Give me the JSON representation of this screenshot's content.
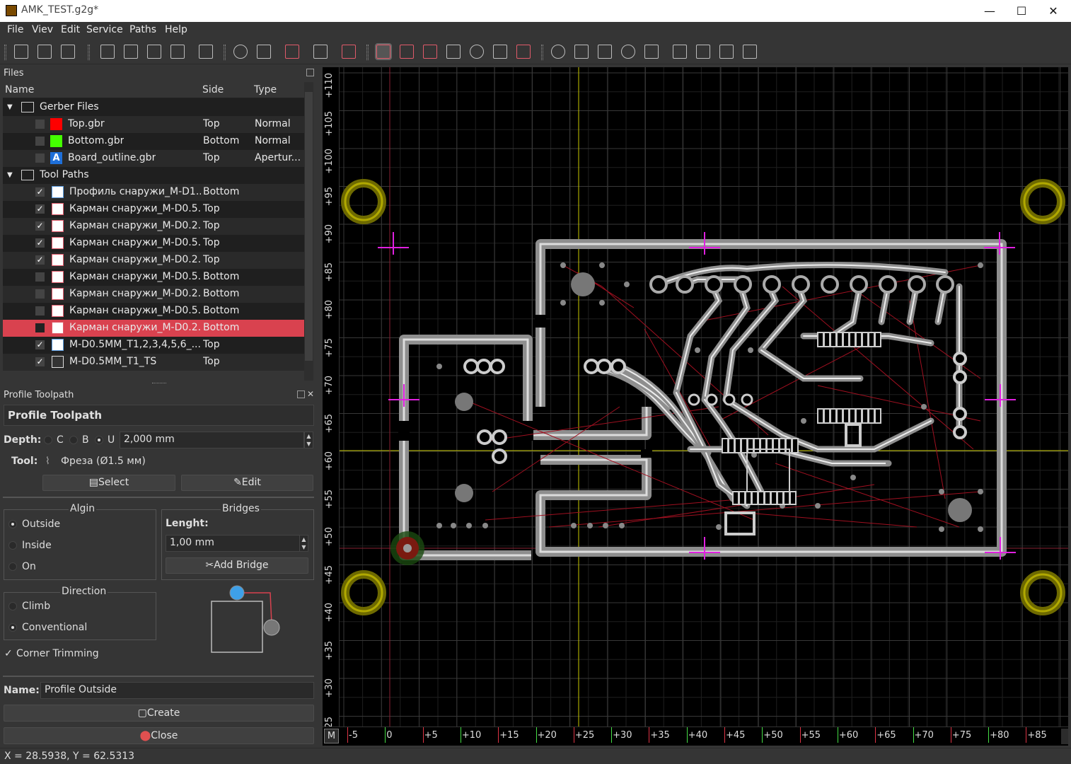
{
  "window": {
    "title": "AMK_TEST.g2g*",
    "minimize": "—",
    "maximize": "☐",
    "close": "✕"
  },
  "menu": [
    {
      "label": "File"
    },
    {
      "label": "Viev"
    },
    {
      "label": "Edit"
    },
    {
      "label": "Service"
    },
    {
      "label": "Paths"
    },
    {
      "label": "Help"
    }
  ],
  "files_dock": {
    "title": "Files",
    "columns": [
      "Name",
      "Side",
      "Type"
    ],
    "gerber_group": "Gerber Files",
    "gerbers": [
      {
        "name": "Top.gbr",
        "side": "Top",
        "type": "Normal",
        "color": "#ff0000"
      },
      {
        "name": "Bottom.gbr",
        "side": "Bottom",
        "type": "Normal",
        "color": "#44ff00"
      },
      {
        "name": "Board_outline.gbr",
        "side": "Top",
        "type": "Apertur...",
        "color": "#1e6fd9",
        "glyph": "A"
      }
    ],
    "tool_group": "Tool Paths",
    "toolpaths": [
      {
        "name": "Профиль снаружи_M-D1...",
        "side": "Bottom",
        "checked": true
      },
      {
        "name": "Карман снаружи_M-D0.5...",
        "side": "Top",
        "checked": true
      },
      {
        "name": "Карман снаружи_M-D0.2...",
        "side": "Top",
        "checked": true
      },
      {
        "name": "Карман снаружи_M-D0.5...",
        "side": "Top",
        "checked": true
      },
      {
        "name": "Карман снаружи_M-D0.2...",
        "side": "Top",
        "checked": true
      },
      {
        "name": "Карман снаружи_M-D0.5...",
        "side": "Bottom",
        "checked": false
      },
      {
        "name": "Карман снаружи_M-D0.2...",
        "side": "Bottom",
        "checked": false
      },
      {
        "name": "Карман снаружи_M-D0.5...",
        "side": "Bottom",
        "checked": false
      },
      {
        "name": "Карман снаружи_M-D0.2...",
        "side": "Bottom",
        "checked": false,
        "selected": true
      },
      {
        "name": "M-D0.5MM_T1,2,3,4,5,6_...",
        "side": "Top",
        "checked": true
      },
      {
        "name": "M-D0.5MM_T1_TS",
        "side": "Top",
        "checked": true
      }
    ]
  },
  "profile_dock": {
    "title": "Profile Toolpath",
    "header": "Profile Toolpath",
    "depth_label": "Depth:",
    "depth_opts": [
      "C",
      "B",
      "U"
    ],
    "depth_value": "2,000 mm",
    "tool_label": "Tool:",
    "tool_value": "Фреза (Ø1.5 мм)",
    "select_btn": "Select",
    "edit_btn": "Edit",
    "align_title": "Algin",
    "align_opts": [
      "Outside",
      "Inside",
      "On"
    ],
    "bridges_title": "Bridges",
    "length_label": "Lenght:",
    "length_value": "1,00 mm",
    "add_bridge": "Add Bridge",
    "direction_title": "Direction",
    "direction_opts": [
      "Climb",
      "Conventional"
    ],
    "corner": "Corner Trimming",
    "name_label": "Name:",
    "name_value": "Profile Outside",
    "create_btn": "Create",
    "close_btn": "Close"
  },
  "status": "X = 28.5938, Y = 62.5313",
  "ruler": {
    "x_labels": [
      "-5",
      "0",
      "+5",
      "+10",
      "+15",
      "+20",
      "+25",
      "+30",
      "+35",
      "+40",
      "+45",
      "+50",
      "+55",
      "+60",
      "+65",
      "+70",
      "+75",
      "+80",
      "+85"
    ],
    "y_labels": [
      "+110",
      "+105",
      "+100",
      "+95",
      "+90",
      "+85",
      "+80",
      "+75",
      "+70",
      "+65",
      "+60",
      "+55",
      "+50",
      "+45",
      "+40",
      "+35",
      "+30",
      "25"
    ],
    "corner": "M"
  },
  "colors": {
    "accent": "#d9424f",
    "top": "#ff0000",
    "bottom": "#44ff00",
    "bg": "#353535",
    "viewport": "#000000"
  }
}
